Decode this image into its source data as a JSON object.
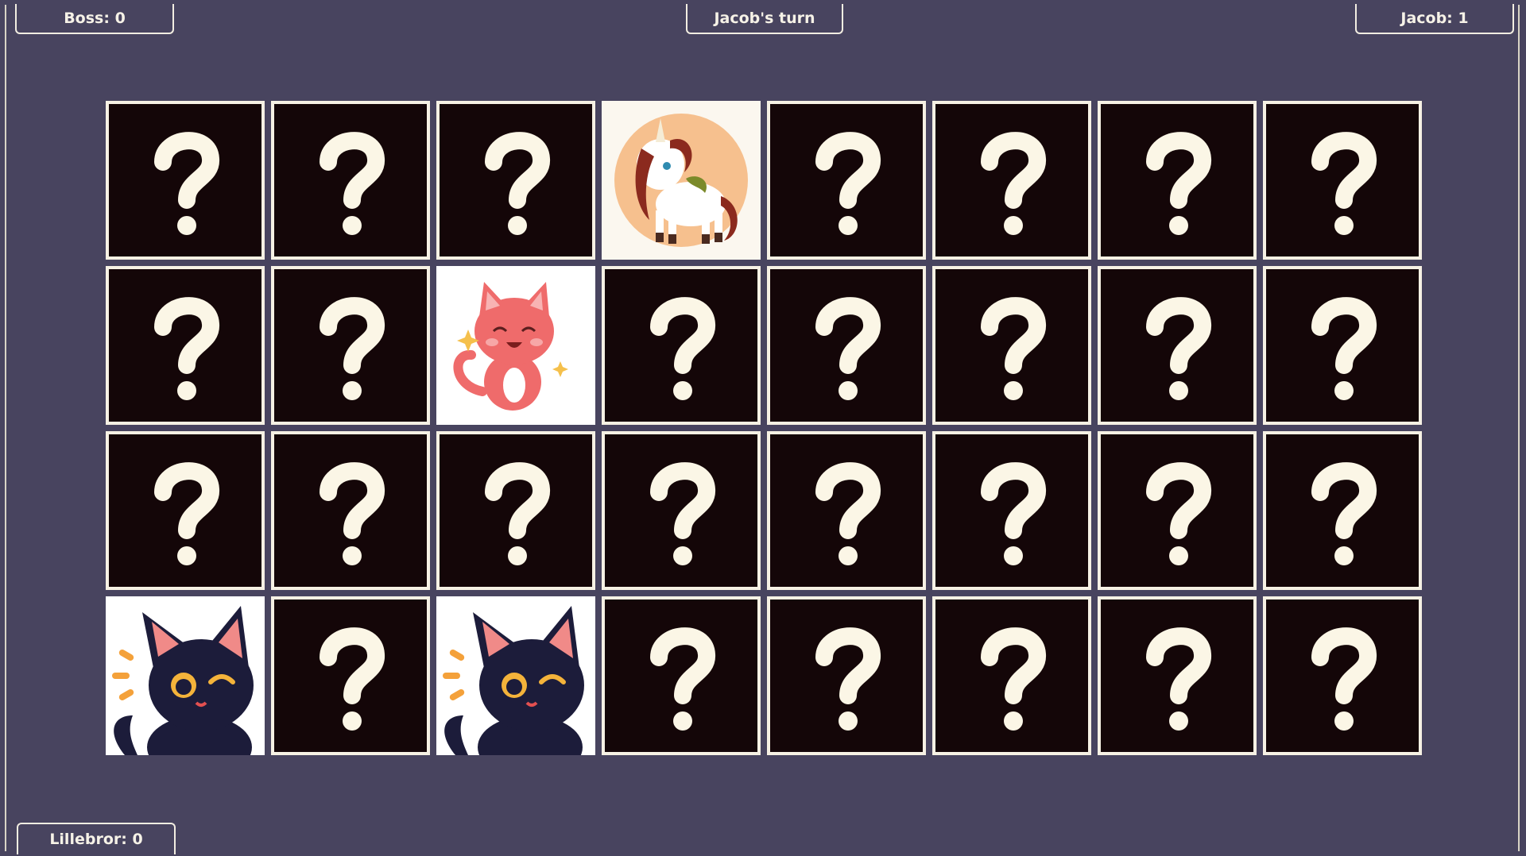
{
  "scores": {
    "boss": "Boss: 0",
    "turn": "Jacob's turn",
    "jacob": "Jacob: 1",
    "lillebror": "Lillebror: 0"
  },
  "cards": [
    {
      "state": "hidden"
    },
    {
      "state": "hidden"
    },
    {
      "state": "hidden"
    },
    {
      "state": "revealed",
      "image": "unicorn"
    },
    {
      "state": "hidden"
    },
    {
      "state": "hidden"
    },
    {
      "state": "hidden"
    },
    {
      "state": "hidden"
    },
    {
      "state": "hidden"
    },
    {
      "state": "hidden"
    },
    {
      "state": "revealed",
      "image": "pink-cat"
    },
    {
      "state": "hidden"
    },
    {
      "state": "hidden"
    },
    {
      "state": "hidden"
    },
    {
      "state": "hidden"
    },
    {
      "state": "hidden"
    },
    {
      "state": "hidden"
    },
    {
      "state": "hidden"
    },
    {
      "state": "hidden"
    },
    {
      "state": "hidden"
    },
    {
      "state": "hidden"
    },
    {
      "state": "hidden"
    },
    {
      "state": "hidden"
    },
    {
      "state": "hidden"
    },
    {
      "state": "revealed",
      "image": "black-cat"
    },
    {
      "state": "hidden"
    },
    {
      "state": "revealed",
      "image": "black-cat"
    },
    {
      "state": "hidden"
    },
    {
      "state": "hidden"
    },
    {
      "state": "hidden"
    },
    {
      "state": "hidden"
    },
    {
      "state": "hidden"
    }
  ],
  "colors": {
    "background": "#48445f",
    "card_back": "#140608",
    "card_border": "#f6f1e4",
    "question_mark": "#fbf6e6"
  },
  "icons": {
    "hidden": "question-mark-icon",
    "unicorn": "unicorn-card-image",
    "pink-cat": "pink-cat-card-image",
    "black-cat": "black-cat-card-image"
  }
}
